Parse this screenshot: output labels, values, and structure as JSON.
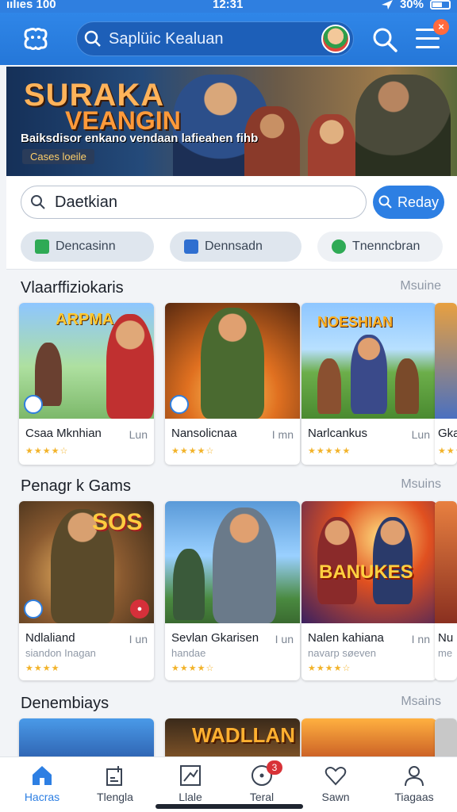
{
  "status": {
    "left": "ıılıes 100",
    "time": "12:31",
    "right": "30%"
  },
  "header": {
    "search_placeholder": "Saplüic Kealuan",
    "menu_badge": "×"
  },
  "banner": {
    "title_line1": "SURAKA",
    "title_line2": "VEANGIN",
    "subtitle": "Baiksdisor enkano vendaan lafieahen fihb",
    "pill": "Cases loeile"
  },
  "search": {
    "value": "Daetkian",
    "button_label": "Reday"
  },
  "chips": [
    {
      "label": "Dencasinn",
      "color": "#2faa55"
    },
    {
      "label": "Dennsadn",
      "color": "#2f6fd0"
    },
    {
      "label": "Tnenncbran",
      "color": "#2faa55"
    }
  ],
  "sections": [
    {
      "title": "Vlaarffiziokaris",
      "more": "Msuine",
      "cards": [
        {
          "name": "Csaa Mknhian",
          "tag": "Lun",
          "subtitle": "",
          "stars": "★★★★☆",
          "overlay": "ARPMA"
        },
        {
          "name": "Nansolicnaa",
          "tag": "I mn",
          "subtitle": "",
          "stars": "★★★★☆",
          "overlay": ""
        },
        {
          "name": "Narlcankus",
          "tag": "Lun",
          "subtitle": "",
          "stars": "★★★★★",
          "overlay": "NOESHIAN"
        },
        {
          "name": "Gka",
          "tag": "",
          "subtitle": "",
          "stars": "★★★",
          "overlay": ""
        }
      ]
    },
    {
      "title": "Penagr k Gams",
      "more": "Msuins",
      "cards": [
        {
          "name": "Ndlaliand",
          "tag": "I un",
          "subtitle": "siandon Inagan",
          "stars": "★★★★",
          "overlay": "SOS"
        },
        {
          "name": "Sevlan Gkarisen",
          "tag": "I un",
          "subtitle": "handae",
          "stars": "★★★★☆",
          "overlay": ""
        },
        {
          "name": "Nalen kahiana",
          "tag": "I nn",
          "subtitle": "navarp søeven",
          "stars": "★★★★☆",
          "overlay": "BANUKES"
        },
        {
          "name": "Nu",
          "tag": "",
          "subtitle": "me",
          "stars": "★★",
          "overlay": ""
        }
      ]
    },
    {
      "title": "Denembiays",
      "more": "Msains",
      "cards": [
        {
          "name": "",
          "overlay": ""
        },
        {
          "name": "",
          "overlay": "WADLLAN"
        },
        {
          "name": "",
          "overlay": ""
        },
        {
          "name": "",
          "overlay": ""
        }
      ]
    }
  ],
  "bottom_nav": [
    {
      "label": "Hacras",
      "icon": "home-icon",
      "active": true
    },
    {
      "label": "Tlengla",
      "icon": "add-document-icon",
      "active": false
    },
    {
      "label": "Llale",
      "icon": "chart-icon",
      "active": false
    },
    {
      "label": "Teral",
      "icon": "disc-icon",
      "active": false,
      "badge": "3"
    },
    {
      "label": "Sawn",
      "icon": "heart-icon",
      "active": false
    },
    {
      "label": "Tiagaas",
      "icon": "profile-icon",
      "active": false
    }
  ],
  "colors": {
    "accent": "#2d7fe3",
    "header": "#2f86e8",
    "star": "#f2b32a"
  }
}
